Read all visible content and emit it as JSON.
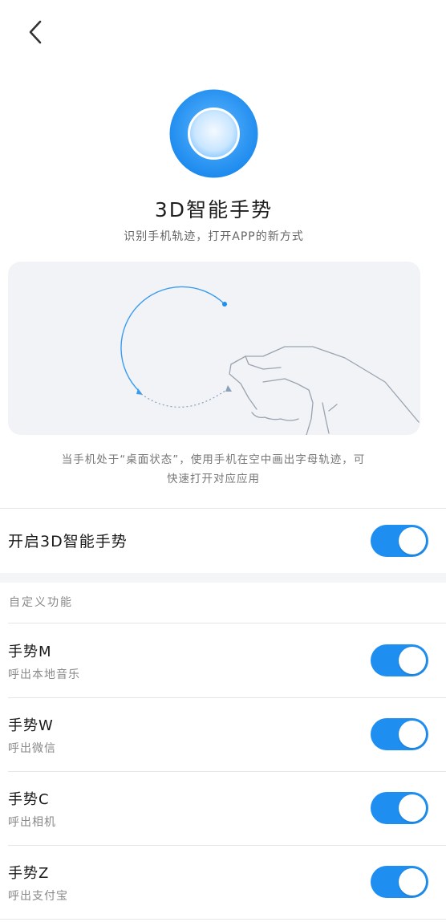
{
  "header": {
    "back_icon": "chevron-left-icon"
  },
  "hero": {
    "icon": "gesture-ring-icon",
    "title": "3D智能手势",
    "subtitle": "识别手机轨迹，打开APP的新方式"
  },
  "illustration": {
    "icon": "hand-gesture-illustration"
  },
  "description": {
    "line1": "当手机处于“桌面状态”，使用手机在空中画出字母轨迹，可",
    "line2": "快速打开对应应用"
  },
  "main_toggle": {
    "label": "开启3D智能手势",
    "on": true
  },
  "custom_section": {
    "header": "自定义功能",
    "items": [
      {
        "title": "手势M",
        "subtitle": "呼出本地音乐",
        "on": true
      },
      {
        "title": "手势W",
        "subtitle": "呼出微信",
        "on": true
      },
      {
        "title": "手势C",
        "subtitle": "呼出相机",
        "on": true
      },
      {
        "title": "手势Z",
        "subtitle": "呼出支付宝",
        "on": true
      }
    ]
  },
  "colors": {
    "accent": "#1e8ef0",
    "toggle_on": "#1e8ef0",
    "divider": "#e6e6e6"
  }
}
